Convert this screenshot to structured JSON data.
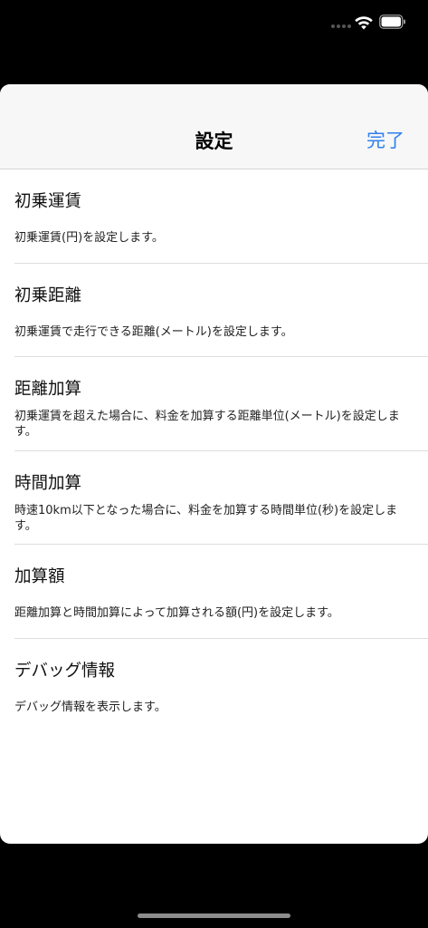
{
  "status_bar": {
    "wifi_icon": "wifi-icon",
    "battery_icon": "battery-icon"
  },
  "nav": {
    "title": "設定",
    "done_label": "完了"
  },
  "colors": {
    "accent": "#2f80ed",
    "background": "#000000",
    "sheet": "#ffffff",
    "nav_bar": "#f7f7f7"
  },
  "settings": [
    {
      "title": "初乗運賃",
      "description": "初乗運賃(円)を設定します。"
    },
    {
      "title": "初乗距離",
      "description": "初乗運賃で走行できる距離(メートル)を設定します。"
    },
    {
      "title": "距離加算",
      "description": "初乗運賃を超えた場合に、料金を加算する距離単位(メートル)を設定します。"
    },
    {
      "title": "時間加算",
      "description": "時速10km以下となった場合に、料金を加算する時間単位(秒)を設定します。"
    },
    {
      "title": "加算額",
      "description": "距離加算と時間加算によって加算される額(円)を設定します。"
    },
    {
      "title": "デバッグ情報",
      "description": "デバッグ情報を表示します。"
    }
  ]
}
